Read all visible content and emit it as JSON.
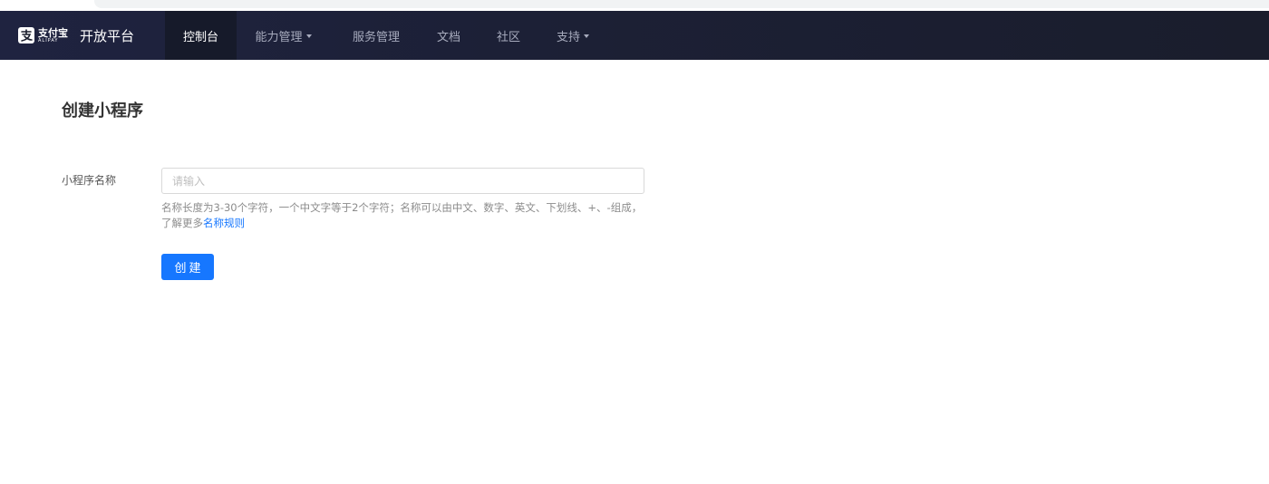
{
  "brand": {
    "logo_cn": "支付宝",
    "logo_en": "ALIPAY",
    "title": "开放平台"
  },
  "nav": {
    "items": [
      {
        "label": "控制台",
        "active": true,
        "dropdown": false
      },
      {
        "label": "能力管理",
        "active": false,
        "dropdown": true
      },
      {
        "label": "服务管理",
        "active": false,
        "dropdown": false
      },
      {
        "label": "文档",
        "active": false,
        "dropdown": false
      },
      {
        "label": "社区",
        "active": false,
        "dropdown": false
      },
      {
        "label": "支持",
        "active": false,
        "dropdown": true
      }
    ]
  },
  "page": {
    "title": "创建小程序"
  },
  "form": {
    "name_label": "小程序名称",
    "name_value": "",
    "name_placeholder": "请输入",
    "hint_text": "名称长度为3-30个字符，一个中文字等于2个字符；名称可以由中文、数字、英文、下划线、+、-组成，了解更多",
    "hint_link": "名称规则",
    "submit_label": "创建"
  },
  "colors": {
    "nav_bg": "#1c2036",
    "nav_active_bg": "#161a2a",
    "primary": "#1677ff"
  }
}
